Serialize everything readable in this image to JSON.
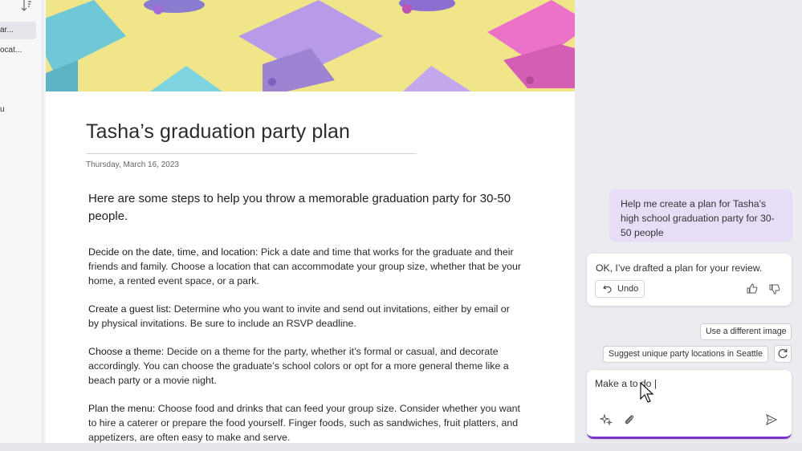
{
  "sidebar": {
    "sort_icon": "sort-descending-icon",
    "items": [
      {
        "label": "ar..."
      },
      {
        "label": "ocat..."
      },
      {
        "label": "u"
      }
    ]
  },
  "document": {
    "title": "Tasha’s graduation party plan",
    "date": "Thursday, March 16, 2023",
    "intro": "Here are some steps to help you throw a memorable graduation party for 30-50 people.",
    "sections": [
      {
        "heading": "Decide on the date, time, and location:",
        "body": " Pick a date and time that works for the graduate and their friends and family. Choose a location that can accommodate your group size, whether that be your home, a rented event space, or a park."
      },
      {
        "heading": "Create a guest list:",
        "body": " Determine who you want to invite and send out invitations, either by email or by physical invitations. Be sure to include an RSVP deadline."
      },
      {
        "heading": "Choose a theme:",
        "body": " Decide on a theme for the party, whether it’s formal or casual, and decorate accordingly. You can choose the graduate’s school colors or opt for a more general theme like a beach party or a movie night."
      },
      {
        "heading": "Plan the menu:",
        "body": " Choose food and drinks that can feed your group size. Consider whether you want to hire a caterer or prepare the food yourself. Finger foods, such as sandwiches, fruit platters, and appetizers, are often easy to make and serve."
      }
    ]
  },
  "copilot": {
    "user_message": "Help me create a plan for Tasha’s high school graduation party for 30-50 people",
    "bot_message": "OK, I’ve drafted a plan for your review.",
    "undo_label": "Undo",
    "suggestions": [
      "Use a different image",
      "Suggest unique party locations in Seattle"
    ],
    "composer_value": "Make a to do |",
    "icons": [
      "undo-icon",
      "thumbs-up-icon",
      "thumbs-down-icon",
      "refresh-icon",
      "sparkle-icon",
      "paperclip-icon",
      "send-icon",
      "mouse-cursor-icon"
    ],
    "accent_color": "#7a34c9"
  },
  "colors": {
    "banner_yellow": "#f1e58a",
    "cap_cyan": "#6fc8d8",
    "cap_purple": "#b79ae8",
    "cap_pink": "#ea72c9",
    "user_bubble": "#e7ddf7"
  }
}
